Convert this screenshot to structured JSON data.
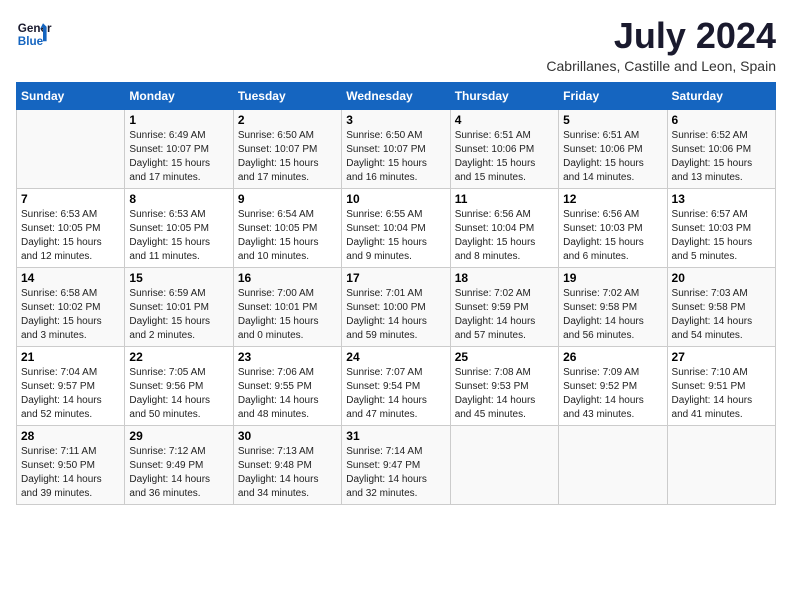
{
  "header": {
    "logo_line1": "General",
    "logo_line2": "Blue",
    "month": "July 2024",
    "location": "Cabrillanes, Castille and Leon, Spain"
  },
  "weekdays": [
    "Sunday",
    "Monday",
    "Tuesday",
    "Wednesday",
    "Thursday",
    "Friday",
    "Saturday"
  ],
  "weeks": [
    [
      {
        "day": "",
        "info": ""
      },
      {
        "day": "1",
        "info": "Sunrise: 6:49 AM\nSunset: 10:07 PM\nDaylight: 15 hours\nand 17 minutes."
      },
      {
        "day": "2",
        "info": "Sunrise: 6:50 AM\nSunset: 10:07 PM\nDaylight: 15 hours\nand 17 minutes."
      },
      {
        "day": "3",
        "info": "Sunrise: 6:50 AM\nSunset: 10:07 PM\nDaylight: 15 hours\nand 16 minutes."
      },
      {
        "day": "4",
        "info": "Sunrise: 6:51 AM\nSunset: 10:06 PM\nDaylight: 15 hours\nand 15 minutes."
      },
      {
        "day": "5",
        "info": "Sunrise: 6:51 AM\nSunset: 10:06 PM\nDaylight: 15 hours\nand 14 minutes."
      },
      {
        "day": "6",
        "info": "Sunrise: 6:52 AM\nSunset: 10:06 PM\nDaylight: 15 hours\nand 13 minutes."
      }
    ],
    [
      {
        "day": "7",
        "info": "Sunrise: 6:53 AM\nSunset: 10:05 PM\nDaylight: 15 hours\nand 12 minutes."
      },
      {
        "day": "8",
        "info": "Sunrise: 6:53 AM\nSunset: 10:05 PM\nDaylight: 15 hours\nand 11 minutes."
      },
      {
        "day": "9",
        "info": "Sunrise: 6:54 AM\nSunset: 10:05 PM\nDaylight: 15 hours\nand 10 minutes."
      },
      {
        "day": "10",
        "info": "Sunrise: 6:55 AM\nSunset: 10:04 PM\nDaylight: 15 hours\nand 9 minutes."
      },
      {
        "day": "11",
        "info": "Sunrise: 6:56 AM\nSunset: 10:04 PM\nDaylight: 15 hours\nand 8 minutes."
      },
      {
        "day": "12",
        "info": "Sunrise: 6:56 AM\nSunset: 10:03 PM\nDaylight: 15 hours\nand 6 minutes."
      },
      {
        "day": "13",
        "info": "Sunrise: 6:57 AM\nSunset: 10:03 PM\nDaylight: 15 hours\nand 5 minutes."
      }
    ],
    [
      {
        "day": "14",
        "info": "Sunrise: 6:58 AM\nSunset: 10:02 PM\nDaylight: 15 hours\nand 3 minutes."
      },
      {
        "day": "15",
        "info": "Sunrise: 6:59 AM\nSunset: 10:01 PM\nDaylight: 15 hours\nand 2 minutes."
      },
      {
        "day": "16",
        "info": "Sunrise: 7:00 AM\nSunset: 10:01 PM\nDaylight: 15 hours\nand 0 minutes."
      },
      {
        "day": "17",
        "info": "Sunrise: 7:01 AM\nSunset: 10:00 PM\nDaylight: 14 hours\nand 59 minutes."
      },
      {
        "day": "18",
        "info": "Sunrise: 7:02 AM\nSunset: 9:59 PM\nDaylight: 14 hours\nand 57 minutes."
      },
      {
        "day": "19",
        "info": "Sunrise: 7:02 AM\nSunset: 9:58 PM\nDaylight: 14 hours\nand 56 minutes."
      },
      {
        "day": "20",
        "info": "Sunrise: 7:03 AM\nSunset: 9:58 PM\nDaylight: 14 hours\nand 54 minutes."
      }
    ],
    [
      {
        "day": "21",
        "info": "Sunrise: 7:04 AM\nSunset: 9:57 PM\nDaylight: 14 hours\nand 52 minutes."
      },
      {
        "day": "22",
        "info": "Sunrise: 7:05 AM\nSunset: 9:56 PM\nDaylight: 14 hours\nand 50 minutes."
      },
      {
        "day": "23",
        "info": "Sunrise: 7:06 AM\nSunset: 9:55 PM\nDaylight: 14 hours\nand 48 minutes."
      },
      {
        "day": "24",
        "info": "Sunrise: 7:07 AM\nSunset: 9:54 PM\nDaylight: 14 hours\nand 47 minutes."
      },
      {
        "day": "25",
        "info": "Sunrise: 7:08 AM\nSunset: 9:53 PM\nDaylight: 14 hours\nand 45 minutes."
      },
      {
        "day": "26",
        "info": "Sunrise: 7:09 AM\nSunset: 9:52 PM\nDaylight: 14 hours\nand 43 minutes."
      },
      {
        "day": "27",
        "info": "Sunrise: 7:10 AM\nSunset: 9:51 PM\nDaylight: 14 hours\nand 41 minutes."
      }
    ],
    [
      {
        "day": "28",
        "info": "Sunrise: 7:11 AM\nSunset: 9:50 PM\nDaylight: 14 hours\nand 39 minutes."
      },
      {
        "day": "29",
        "info": "Sunrise: 7:12 AM\nSunset: 9:49 PM\nDaylight: 14 hours\nand 36 minutes."
      },
      {
        "day": "30",
        "info": "Sunrise: 7:13 AM\nSunset: 9:48 PM\nDaylight: 14 hours\nand 34 minutes."
      },
      {
        "day": "31",
        "info": "Sunrise: 7:14 AM\nSunset: 9:47 PM\nDaylight: 14 hours\nand 32 minutes."
      },
      {
        "day": "",
        "info": ""
      },
      {
        "day": "",
        "info": ""
      },
      {
        "day": "",
        "info": ""
      }
    ]
  ]
}
